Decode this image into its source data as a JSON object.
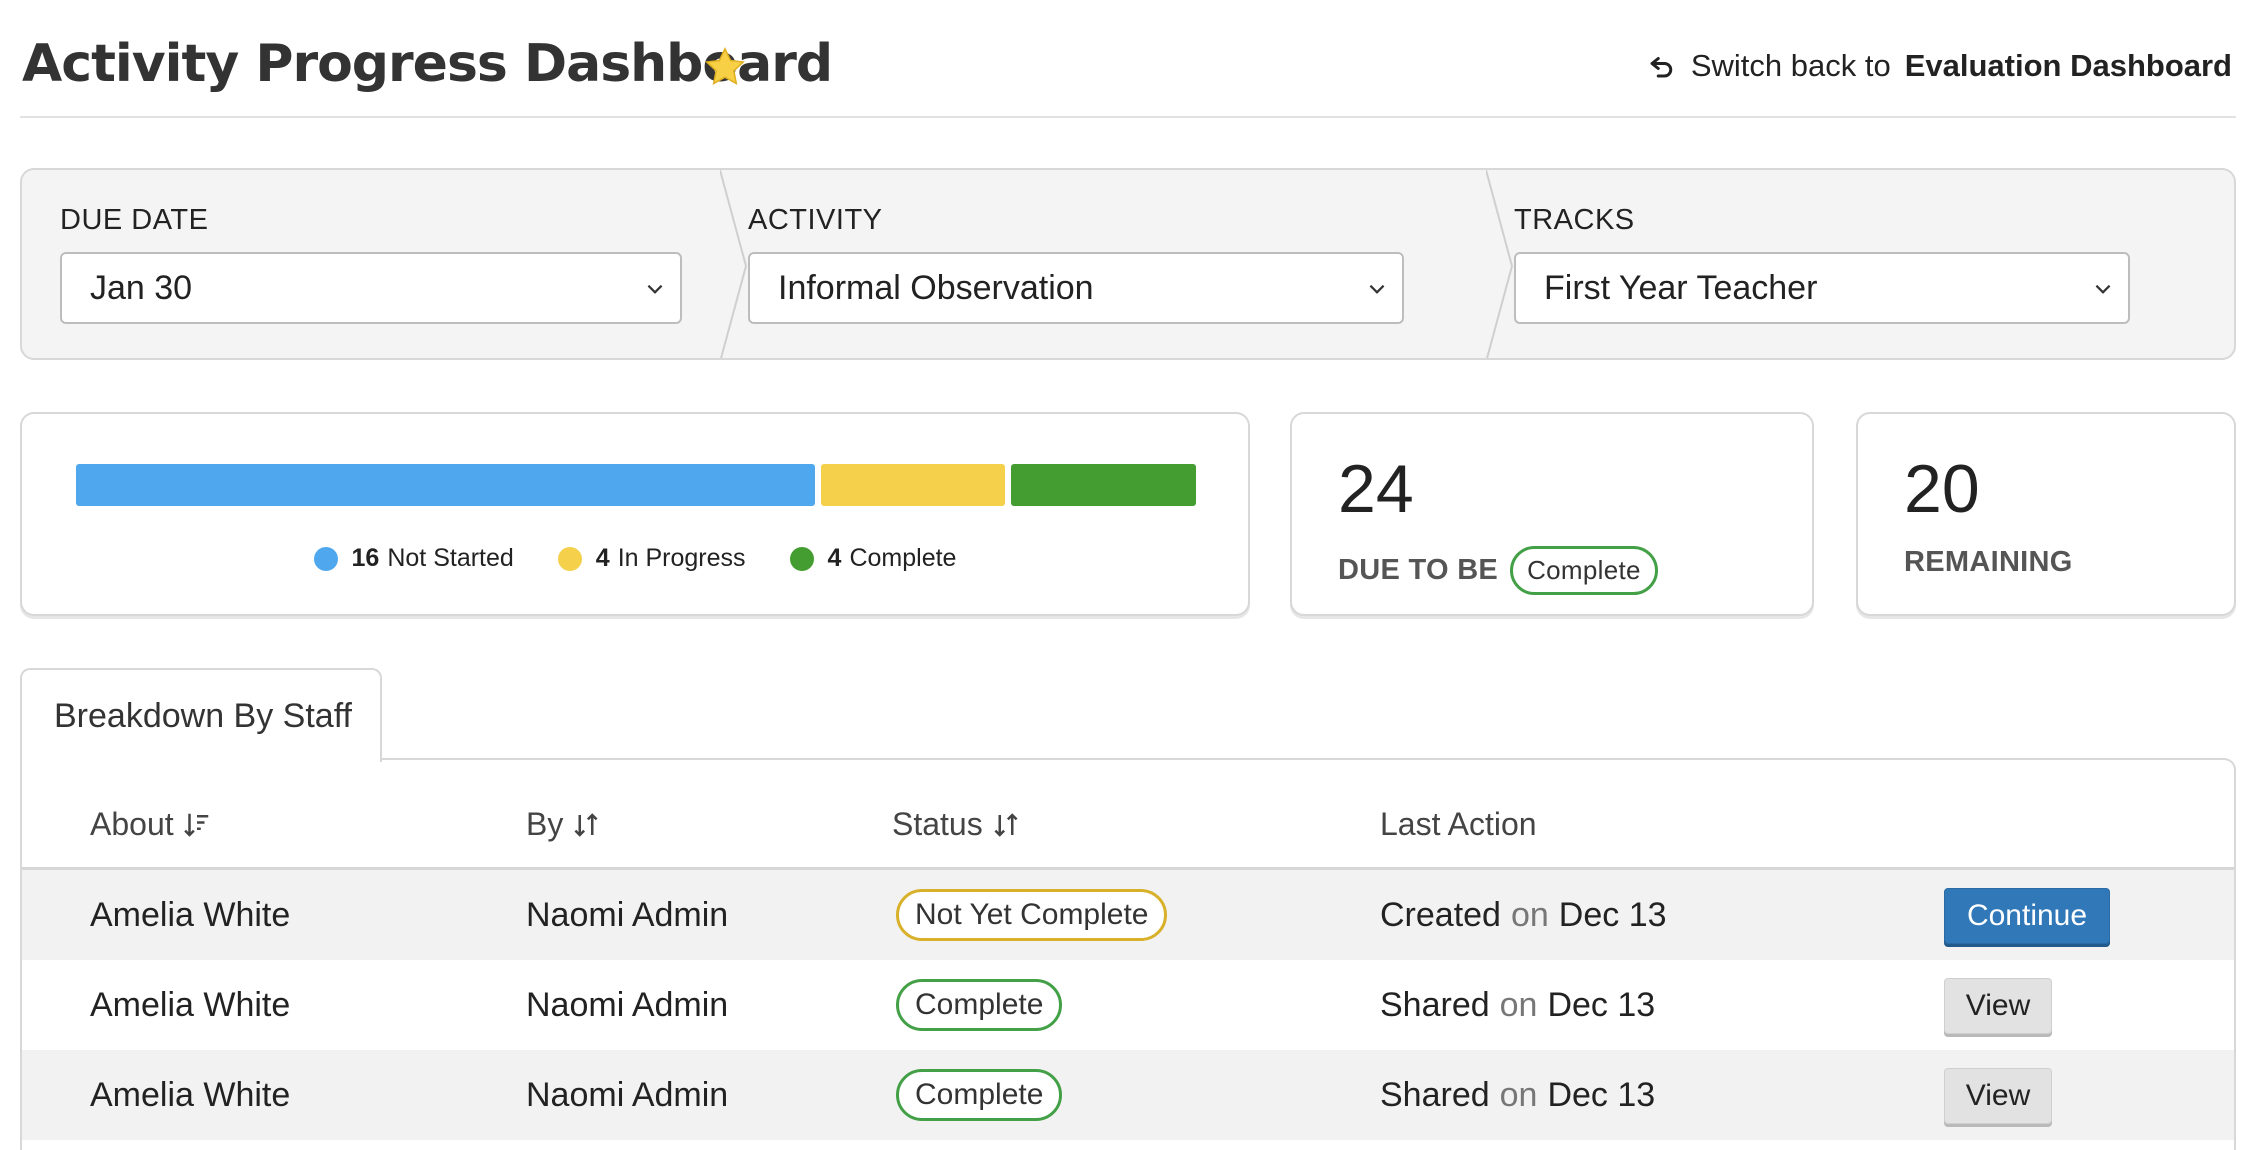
{
  "header": {
    "title": "Activity Progress Dashboard",
    "switch_prefix": "Switch back to",
    "switch_target": "Evaluation Dashboard"
  },
  "filters": {
    "due_date": {
      "label": "DUE DATE",
      "value": "Jan 30"
    },
    "activity": {
      "label": "ACTIVITY",
      "value": "Informal Observation"
    },
    "tracks": {
      "label": "TRACKS",
      "value": "First Year Teacher"
    }
  },
  "progress": {
    "not_started": {
      "count": "16",
      "label": "Not Started",
      "color": "#4fa8ee"
    },
    "in_progress": {
      "count": "4",
      "label": "In Progress",
      "color": "#f4d04b"
    },
    "complete": {
      "count": "4",
      "label": "Complete",
      "color": "#449d30"
    }
  },
  "due_card": {
    "number": "24",
    "caption": "DUE TO BE",
    "pill": "Complete"
  },
  "remaining_card": {
    "number": "20",
    "caption": "REMAINING"
  },
  "tabs": [
    {
      "label": "Breakdown By Staff"
    }
  ],
  "table": {
    "columns": {
      "about": "About",
      "by": "By",
      "status": "Status",
      "last_action": "Last Action"
    },
    "connector": "on",
    "rows": [
      {
        "about": "Amelia White",
        "by": "Naomi Admin",
        "status": "Not Yet Complete",
        "action": "Created",
        "date": "Dec 13",
        "button": "Continue"
      },
      {
        "about": "Amelia White",
        "by": "Naomi Admin",
        "status": "Complete",
        "action": "Shared",
        "date": "Dec 13",
        "button": "View"
      },
      {
        "about": "Amelia White",
        "by": "Naomi Admin",
        "status": "Complete",
        "action": "Shared",
        "date": "Dec 13",
        "button": "View"
      }
    ]
  }
}
